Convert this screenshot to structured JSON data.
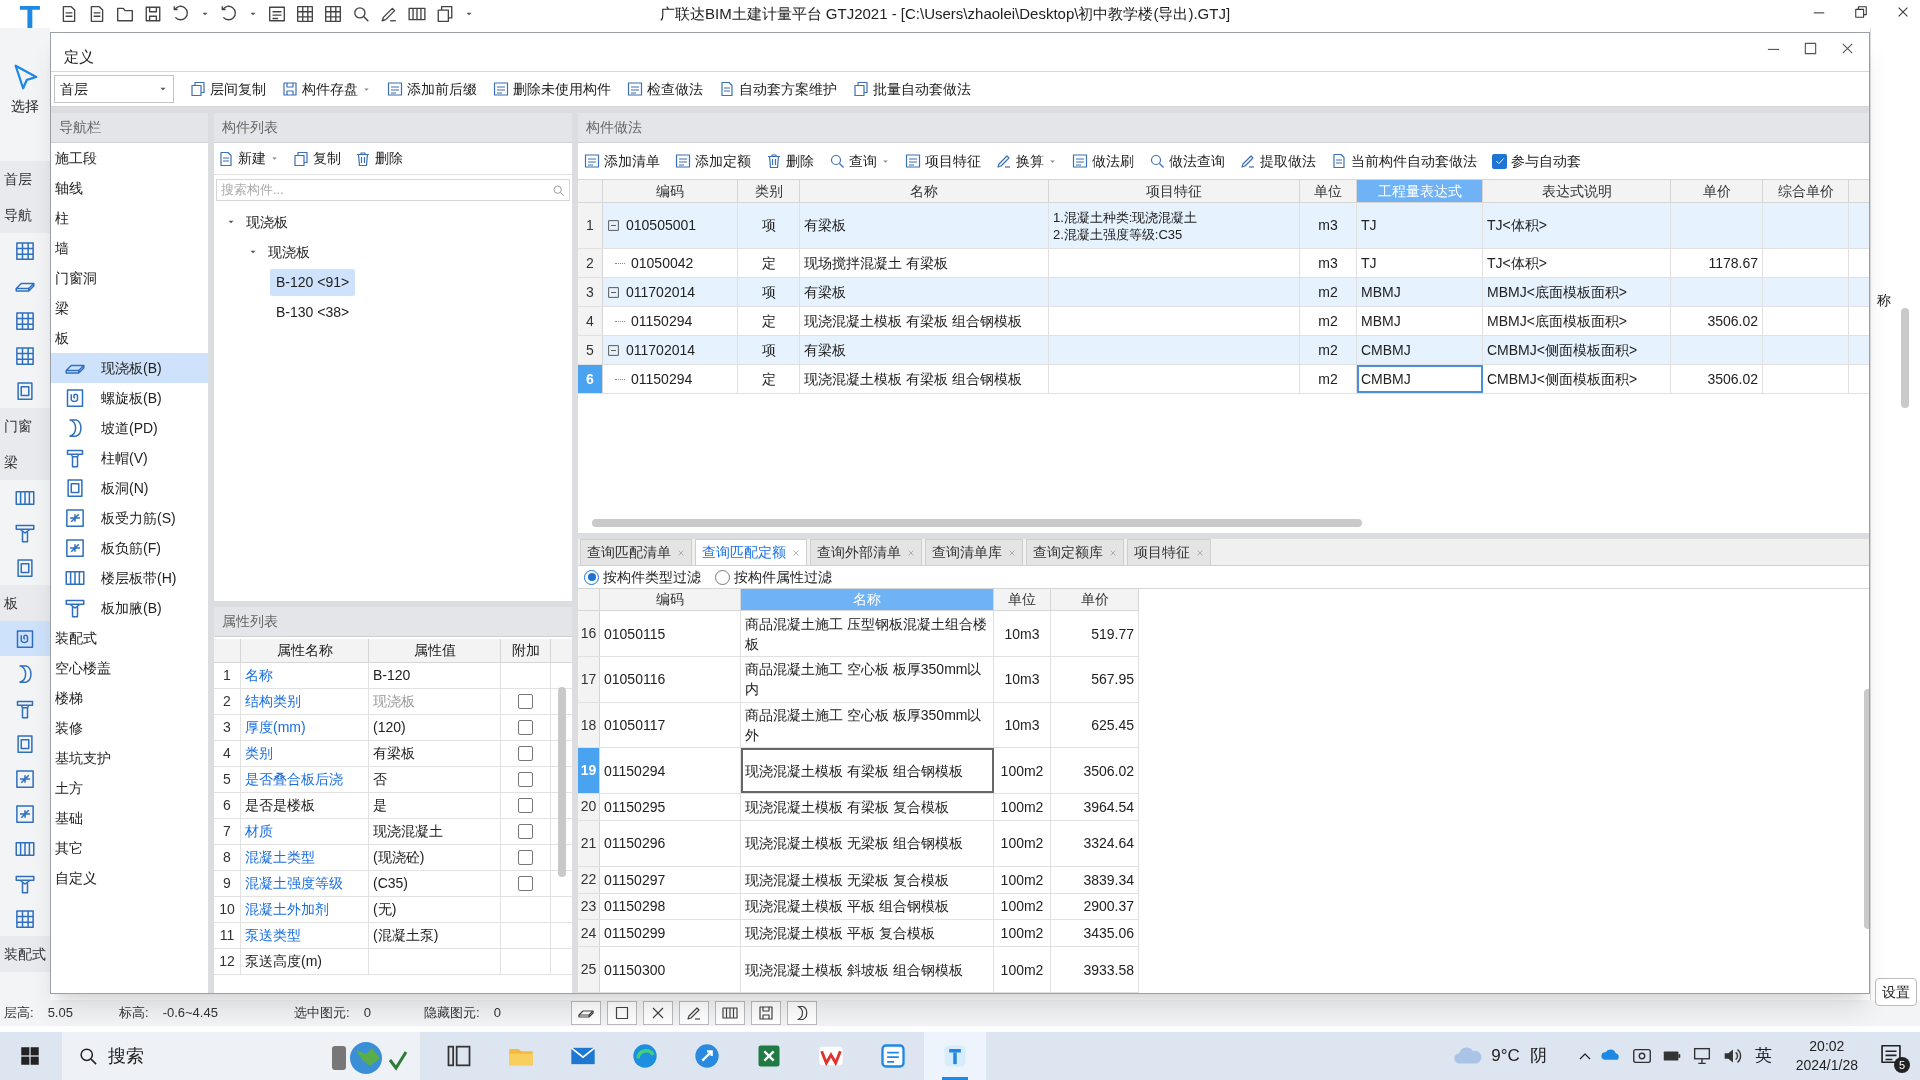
{
  "app": {
    "logo": "T",
    "title": "广联达BIM土建计量平台 GTJ2021 - [C:\\Users\\zhaolei\\Desktop\\初中教学楼(导出).GTJ]",
    "ribbon_label": "选择"
  },
  "background_left": [
    {
      "kind": "label",
      "text": "首层"
    },
    {
      "kind": "label",
      "text": "导航"
    },
    {
      "kind": "icon"
    },
    {
      "kind": "icon"
    },
    {
      "kind": "icon"
    },
    {
      "kind": "icon"
    },
    {
      "kind": "icon"
    },
    {
      "kind": "label",
      "text": "门窗"
    },
    {
      "kind": "label",
      "text": "梁"
    },
    {
      "kind": "icon"
    },
    {
      "kind": "icon"
    },
    {
      "kind": "icon"
    },
    {
      "kind": "label",
      "text": "板"
    },
    {
      "kind": "icon",
      "selected": true
    },
    {
      "kind": "icon"
    },
    {
      "kind": "icon"
    },
    {
      "kind": "icon"
    },
    {
      "kind": "icon"
    },
    {
      "kind": "icon"
    },
    {
      "kind": "icon"
    },
    {
      "kind": "icon"
    },
    {
      "kind": "icon"
    },
    {
      "kind": "label",
      "text": "装配式"
    }
  ],
  "background_right": {
    "column_label": "称",
    "button": "设置"
  },
  "dialog": {
    "title": "定义",
    "floor": "首层",
    "toolbar": [
      {
        "label": "层间复制",
        "kind": "button"
      },
      {
        "label": "构件存盘",
        "kind": "dropdown"
      },
      {
        "label": "添加前后缀",
        "kind": "button"
      },
      {
        "label": "删除未使用构件",
        "kind": "button"
      },
      {
        "label": "检查做法",
        "kind": "button"
      },
      {
        "label": "自动套方案维护",
        "kind": "button"
      },
      {
        "label": "批量自动套做法",
        "kind": "button"
      }
    ]
  },
  "nav": {
    "title": "导航栏",
    "items": [
      {
        "label": "施工段",
        "selected": false
      },
      {
        "label": "轴线",
        "selected": false
      },
      {
        "label": "柱",
        "selected": false
      },
      {
        "label": "墙",
        "selected": false
      },
      {
        "label": "门窗洞",
        "selected": false
      },
      {
        "label": "梁",
        "selected": false
      },
      {
        "label": "板",
        "selected": false,
        "children": [
          {
            "label": "现浇板(B)",
            "selected": true
          },
          {
            "label": "螺旋板(B)",
            "selected": false
          },
          {
            "label": "坡道(PD)",
            "selected": false
          },
          {
            "label": "柱帽(V)",
            "selected": false
          },
          {
            "label": "板洞(N)",
            "selected": false
          },
          {
            "label": "板受力筋(S)",
            "selected": false
          },
          {
            "label": "板负筋(F)",
            "selected": false
          },
          {
            "label": "楼层板带(H)",
            "selected": false
          },
          {
            "label": "板加腋(B)",
            "selected": false
          }
        ]
      },
      {
        "label": "装配式",
        "selected": false
      },
      {
        "label": "空心楼盖",
        "selected": false
      },
      {
        "label": "楼梯",
        "selected": false
      },
      {
        "label": "装修",
        "selected": false
      },
      {
        "label": "基坑支护",
        "selected": false
      },
      {
        "label": "土方",
        "selected": false
      },
      {
        "label": "基础",
        "selected": false
      },
      {
        "label": "其它",
        "selected": false
      },
      {
        "label": "自定义",
        "selected": false
      }
    ]
  },
  "components": {
    "title": "构件列表",
    "toolbar": [
      {
        "label": "新建",
        "kind": "dropdown"
      },
      {
        "label": "复制",
        "kind": "button"
      },
      {
        "label": "删除",
        "kind": "button"
      }
    ],
    "search": {
      "placeholder": "搜索构件..."
    },
    "tree": [
      {
        "label": "现浇板",
        "expanded": true,
        "children": [
          {
            "label": "现浇板",
            "expanded": true,
            "children": [
              {
                "label": "B-120 <91>",
                "selected": true
              },
              {
                "label": "B-130 <38>",
                "selected": false
              }
            ]
          }
        ]
      }
    ]
  },
  "properties": {
    "title": "属性列表",
    "columns": [
      "属性名称",
      "属性值",
      "附加"
    ],
    "rows": [
      {
        "num": "1",
        "name": "名称",
        "value": "B-120",
        "link": true,
        "kind": "plain"
      },
      {
        "num": "2",
        "name": "结构类别",
        "value": "现浇板",
        "link": true,
        "muted": true,
        "kind": "checkbox",
        "checked": false
      },
      {
        "num": "3",
        "name": "厚度(mm)",
        "value": "(120)",
        "link": true,
        "kind": "checkbox",
        "checked": false
      },
      {
        "num": "4",
        "name": "类别",
        "value": "有梁板",
        "link": true,
        "kind": "checkbox",
        "checked": false
      },
      {
        "num": "5",
        "name": "是否叠合板后浇",
        "value": "否",
        "link": true,
        "kind": "checkbox",
        "checked": false
      },
      {
        "num": "6",
        "name": "是否是楼板",
        "value": "是",
        "link": false,
        "kind": "checkbox",
        "checked": false
      },
      {
        "num": "7",
        "name": "材质",
        "value": "现浇混凝土",
        "link": true,
        "kind": "checkbox",
        "checked": false
      },
      {
        "num": "8",
        "name": "混凝土类型",
        "value": "(现浇砼)",
        "link": true,
        "kind": "checkbox",
        "checked": false
      },
      {
        "num": "9",
        "name": "混凝土强度等级",
        "value": "(C35)",
        "link": true,
        "kind": "checkbox",
        "checked": false
      },
      {
        "num": "10",
        "name": "混凝土外加剂",
        "value": "(无)",
        "link": true,
        "kind": "plain"
      },
      {
        "num": "11",
        "name": "泵送类型",
        "value": "(混凝土泵)",
        "link": true,
        "kind": "plain"
      },
      {
        "num": "12",
        "name": "泵送高度(m)",
        "link": false,
        "kind": "plain"
      }
    ]
  },
  "methods": {
    "title": "构件做法",
    "toolbar": [
      {
        "label": "添加清单",
        "kind": "button"
      },
      {
        "label": "添加定额",
        "kind": "button"
      },
      {
        "label": "删除",
        "kind": "button"
      },
      {
        "label": "查询",
        "kind": "dropdown"
      },
      {
        "label": "项目特征",
        "kind": "button"
      },
      {
        "label": "换算",
        "kind": "dropdown"
      },
      {
        "label": "做法刷",
        "kind": "button"
      },
      {
        "label": "做法查询",
        "kind": "button"
      },
      {
        "label": "提取做法",
        "kind": "button"
      },
      {
        "label": "当前构件自动套做法",
        "kind": "button"
      },
      {
        "label": "参与自动套",
        "kind": "checkbox",
        "checked": true
      }
    ],
    "columns": [
      {
        "label": "编码",
        "selected": false
      },
      {
        "label": "类别",
        "selected": false
      },
      {
        "label": "名称",
        "selected": false
      },
      {
        "label": "项目特征",
        "selected": false
      },
      {
        "label": "单位",
        "selected": false
      },
      {
        "label": "工程量表达式",
        "selected": true
      },
      {
        "label": "表达式说明",
        "selected": false
      },
      {
        "label": "单价",
        "selected": false
      },
      {
        "label": "综合单价",
        "selected": false
      }
    ],
    "rows": [
      {
        "num": "1",
        "kind": "bill",
        "selected": false,
        "code": "010505001",
        "type": "项",
        "name": "有梁板",
        "feature": [
          "1.混凝土种类:现浇混凝土",
          "2.混凝土强度等级:C35"
        ],
        "unit": "m3",
        "expr": "TJ",
        "expr_desc": "TJ<体积>"
      },
      {
        "num": "2",
        "kind": "quota",
        "selected": false,
        "code": "01050042",
        "type": "定",
        "name": "现场搅拌混凝土 有梁板",
        "unit": "m3",
        "expr": "TJ",
        "expr_desc": "TJ<体积>",
        "price": "1178.67"
      },
      {
        "num": "3",
        "kind": "bill",
        "selected": false,
        "code": "011702014",
        "type": "项",
        "name": "有梁板",
        "unit": "m2",
        "expr": "MBMJ",
        "expr_desc": "MBMJ<底面模板面积>"
      },
      {
        "num": "4",
        "kind": "quota",
        "selected": false,
        "code": "01150294",
        "type": "定",
        "name": "现浇混凝土模板 有梁板 组合钢模板",
        "unit": "m2",
        "expr": "MBMJ",
        "expr_desc": "MBMJ<底面模板面积>",
        "price": "3506.02"
      },
      {
        "num": "5",
        "kind": "bill",
        "selected": false,
        "code": "011702014",
        "type": "项",
        "name": "有梁板",
        "unit": "m2",
        "expr": "CMBMJ",
        "expr_desc": "CMBMJ<侧面模板面积>"
      },
      {
        "num": "6",
        "kind": "quota",
        "selected": true,
        "code": "01150294",
        "type": "定",
        "name": "现浇混凝土模板 有梁板 组合钢模板",
        "unit": "m2",
        "expr": "CMBMJ",
        "expr_desc": "CMBMJ<侧面模板面积>",
        "price": "3506.02"
      }
    ]
  },
  "query": {
    "tabs": [
      {
        "label": "查询匹配清单",
        "selected": false
      },
      {
        "label": "查询匹配定额",
        "selected": true
      },
      {
        "label": "查询外部清单",
        "selected": false
      },
      {
        "label": "查询清单库",
        "selected": false
      },
      {
        "label": "查询定额库",
        "selected": false
      },
      {
        "label": "项目特征",
        "selected": false
      }
    ],
    "filters": [
      {
        "label": "按构件类型过滤",
        "selected": true
      },
      {
        "label": "按构件属性过滤",
        "selected": false
      }
    ],
    "columns": [
      {
        "label": "编码",
        "selected": false
      },
      {
        "label": "名称",
        "selected": true
      },
      {
        "label": "单位",
        "selected": false
      },
      {
        "label": "单价",
        "selected": false
      }
    ],
    "rows": [
      {
        "num": "16",
        "code": "01050115",
        "name": "商品混凝土施工 压型钢板混凝土组合楼板",
        "unit": "10m3",
        "price": "519.77",
        "selected": false
      },
      {
        "num": "17",
        "code": "01050116",
        "name": "商品混凝土施工 空心板 板厚350mm以内",
        "unit": "10m3",
        "price": "567.95",
        "selected": false
      },
      {
        "num": "18",
        "code": "01050117",
        "name": "商品混凝土施工 空心板 板厚350mm以外",
        "unit": "10m3",
        "price": "625.45",
        "selected": false
      },
      {
        "num": "19",
        "code": "01150294",
        "name": "现浇混凝土模板 有梁板 组合钢模板",
        "unit": "100m2",
        "price": "3506.02",
        "selected": true
      },
      {
        "num": "20",
        "code": "01150295",
        "name": "现浇混凝土模板 有梁板 复合模板",
        "unit": "100m2",
        "price": "3964.54",
        "selected": false
      },
      {
        "num": "21",
        "code": "01150296",
        "name": "现浇混凝土模板 无梁板 组合钢模板",
        "unit": "100m2",
        "price": "3324.64",
        "selected": false
      },
      {
        "num": "22",
        "code": "01150297",
        "name": "现浇混凝土模板 无梁板 复合模板",
        "unit": "100m2",
        "price": "3839.34",
        "selected": false
      },
      {
        "num": "23",
        "code": "01150298",
        "name": "现浇混凝土模板 平板 组合钢模板",
        "unit": "100m2",
        "price": "2900.37",
        "selected": false
      },
      {
        "num": "24",
        "code": "01150299",
        "name": "现浇混凝土模板 平板 复合模板",
        "unit": "100m2",
        "price": "3435.06",
        "selected": false
      },
      {
        "num": "25",
        "code": "01150300",
        "name": "现浇混凝土模板 斜坡板 组合钢模板",
        "unit": "100m2",
        "price": "3933.58",
        "selected": false
      }
    ]
  },
  "status_bar": [
    {
      "label": "层高:",
      "value": "5.05"
    },
    {
      "label": "标高:",
      "value": "-0.6~4.45"
    },
    {
      "label": "选中图元:",
      "value": "0"
    },
    {
      "label": "隐藏图元:",
      "value": "0"
    }
  ],
  "taskbar": {
    "search": "搜索",
    "temperature": "9°C",
    "weather": "阴",
    "ime": "英",
    "time": "20:02",
    "date": "2024/1/28",
    "notifications": "5"
  }
}
